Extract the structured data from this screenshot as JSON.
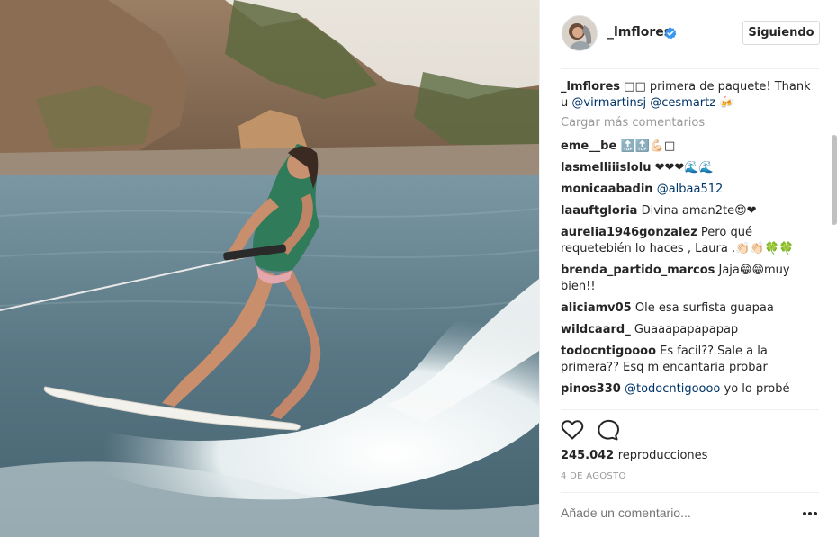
{
  "header": {
    "username": "_lmflores",
    "follow_label": "Siguiendo"
  },
  "caption": {
    "user": "_lmflores",
    "text_a": " □□ primera de paquete! Thank u ",
    "mention1": "@virmartinsj",
    "mention2": "@cesmartz",
    "text_b": " 🍻"
  },
  "load_more_label": "Cargar más comentarios",
  "comments": [
    {
      "user": "eme__be",
      "text": " 🔝🔝💪🏻□"
    },
    {
      "user": "lasmelliiislolu",
      "text": " ❤❤❤🌊🌊"
    },
    {
      "user": "monicaabadin",
      "text": " ",
      "mention": "@albaa512"
    },
    {
      "user": "laauftgloria",
      "text": " Divina aman2te😍❤"
    },
    {
      "user": "aurelia1946gonzalez",
      "text": " Pero qué requetebién lo haces , Laura .👏🏻👏🏻🍀🍀"
    },
    {
      "user": "brenda_partido_marcos",
      "text": " Jaja😁😁muy bien!!"
    },
    {
      "user": "aliciamv05",
      "text": " Ole esa surfista guapaa"
    },
    {
      "user": "wildcaard_",
      "text": " Guaaapapapapap"
    },
    {
      "user": "todocntigoooo",
      "text": " Es facil?? Sale a la primera?? Esq m encantaria probar"
    },
    {
      "user": "pinos330",
      "text": " ",
      "mention": "@todocntigoooo",
      "text_after": " yo lo probé"
    }
  ],
  "actions": {
    "like_icon": "heart-outline-icon",
    "comment_icon": "speech-bubble-icon"
  },
  "views": {
    "count": "245.042",
    "label": "reproducciones"
  },
  "date": "4 DE AGOSTO",
  "add_comment_placeholder": "Añade un comentario...",
  "colors": {
    "mention": "#003569",
    "muted": "#999999",
    "verified": "#3897f0",
    "text": "#262626"
  }
}
